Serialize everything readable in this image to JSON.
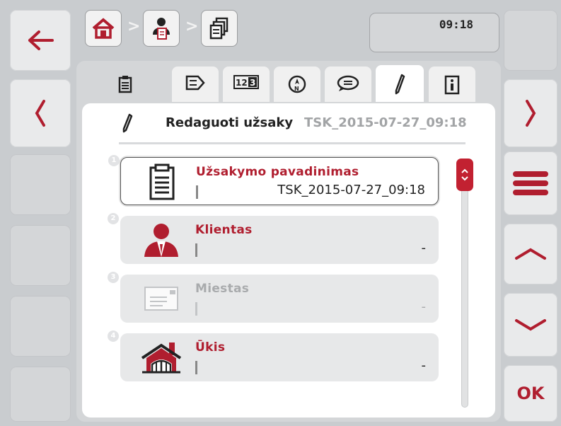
{
  "header": {
    "clock": "09:18",
    "breadcrumb_separator": ">"
  },
  "page": {
    "title": "Redaguoti užsaky",
    "subtitle": "TSK_2015-07-27_09:18"
  },
  "items": [
    {
      "num": "1",
      "label": "Užsakymo pavadinimas",
      "value": "TSK_2015-07-27_09:18",
      "icon": "clipboard-icon"
    },
    {
      "num": "2",
      "label": "Klientas",
      "value": "-",
      "icon": "customer-icon"
    },
    {
      "num": "3",
      "label": "Miestas",
      "value": "-",
      "icon": "location-icon"
    },
    {
      "num": "4",
      "label": "Ūkis",
      "value": "-",
      "icon": "farm-icon"
    }
  ],
  "softkeys": {
    "ok_label": "OK"
  },
  "colors": {
    "accent": "#b01e2f",
    "background": "#c9cccf"
  }
}
